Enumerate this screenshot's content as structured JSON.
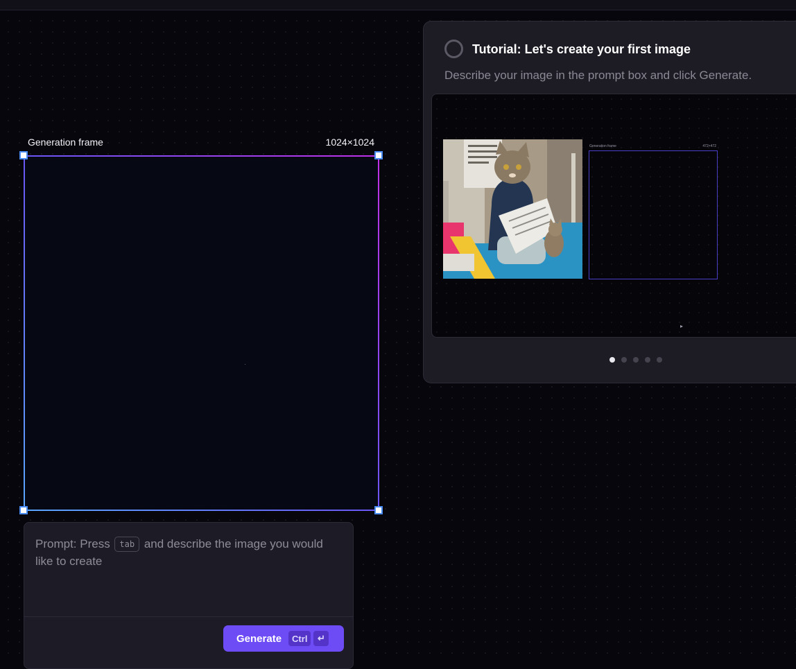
{
  "generation_frame": {
    "title": "Generation frame",
    "size_label": "1024×1024"
  },
  "prompt": {
    "text_before_key": "Prompt: Press ",
    "key": "tab",
    "text_after_key": " and describe the image you would like to create",
    "generate_label": "Generate",
    "shortcut_key": "Ctrl",
    "enter_icon": "↵"
  },
  "tutorial": {
    "title": "Tutorial: Let's create your first image",
    "description": "Describe your image in the prompt box and click Generate.",
    "preview": {
      "image_icon": "cat-reading-newspaper-image",
      "mini_frame_title": "Generation frame",
      "mini_frame_size": "472×472"
    },
    "pagination": {
      "total": 5,
      "active": 1
    }
  },
  "colors": {
    "accent": "#6d4cf6",
    "frame_gradient_start": "#5aa7ff",
    "frame_gradient_end": "#c030e8",
    "background": "#07060c",
    "panel": "#1d1c24"
  }
}
